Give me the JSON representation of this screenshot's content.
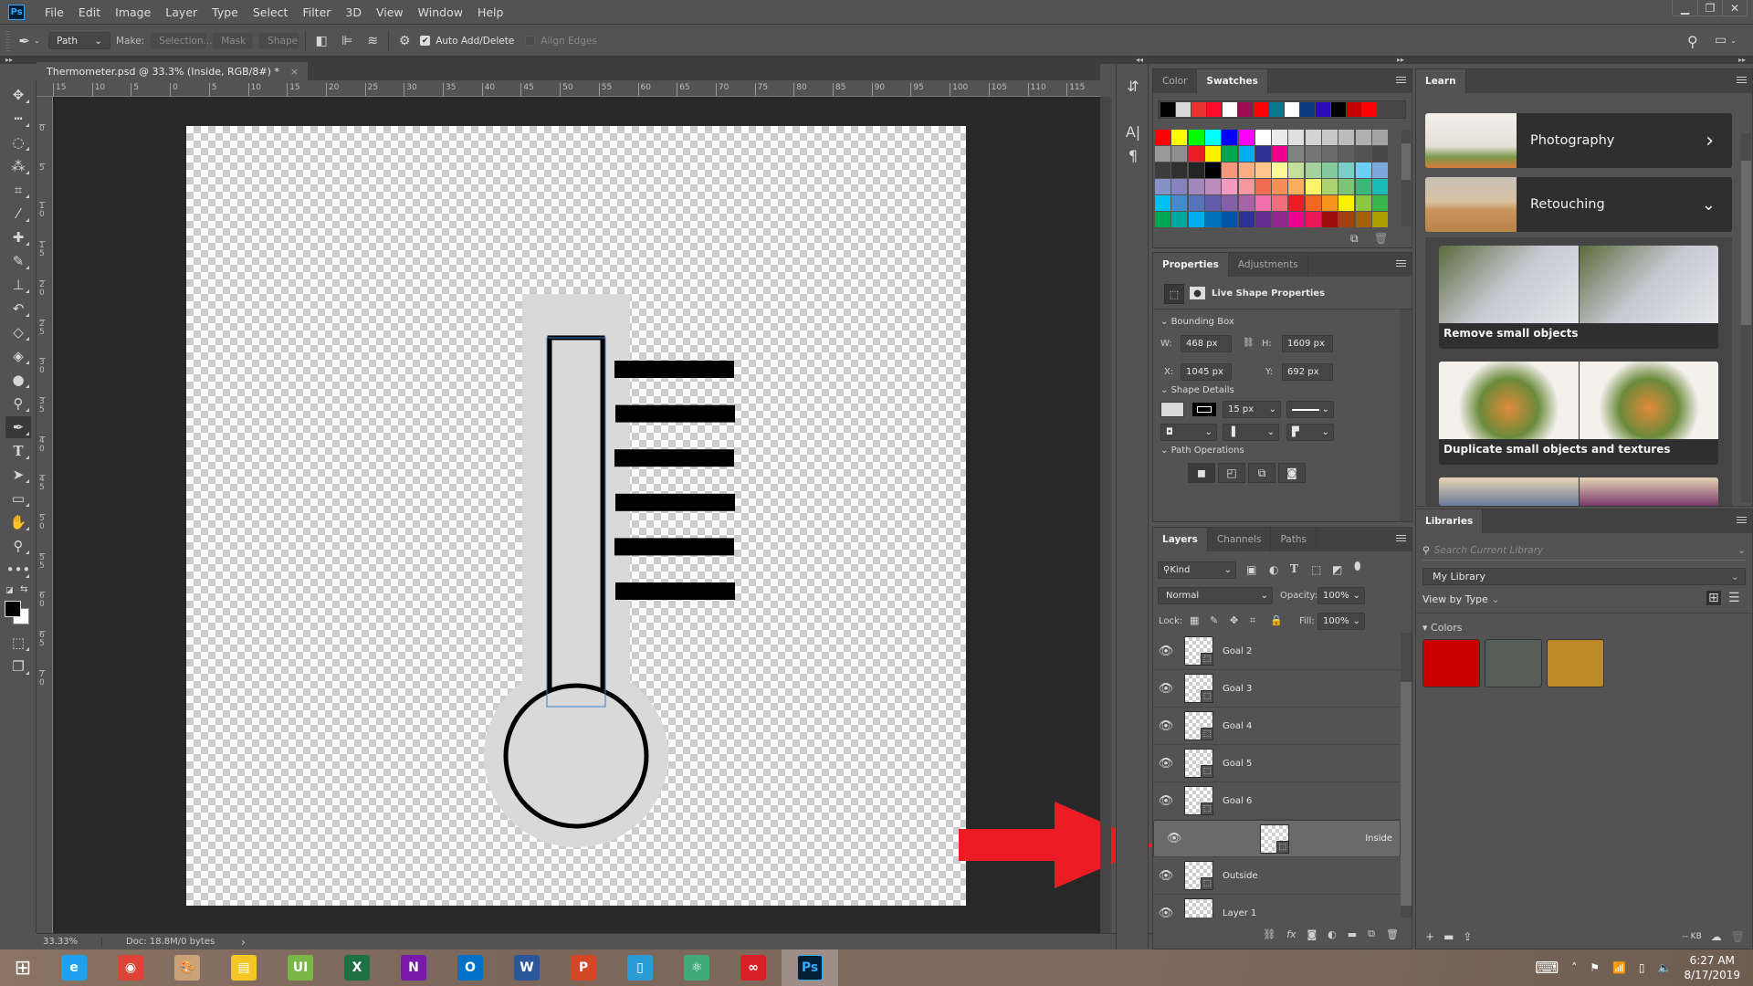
{
  "app": {
    "logo": "Ps",
    "window_controls": [
      "minimize",
      "restore",
      "close"
    ]
  },
  "menu": [
    "File",
    "Edit",
    "Image",
    "Layer",
    "Type",
    "Select",
    "Filter",
    "3D",
    "View",
    "Window",
    "Help"
  ],
  "options_bar": {
    "tool_icon": "pen-icon",
    "mode_select": "Path",
    "make_label": "Make:",
    "make_buttons": [
      "Selection...",
      "Mask",
      "Shape"
    ],
    "auto_add_delete": {
      "label": "Auto Add/Delete",
      "checked": true
    },
    "align_edges": {
      "label": "Align Edges",
      "checked": false
    }
  },
  "document_tab": {
    "title": "Thermometer.psd @ 33.3% (Inside, RGB/8#) *",
    "close": "×"
  },
  "rulers": {
    "top": [
      "15",
      "10",
      "5",
      "0",
      "5",
      "10",
      "15",
      "20",
      "25",
      "30",
      "35",
      "40",
      "45",
      "50",
      "55",
      "60",
      "65",
      "70",
      "75",
      "80",
      "85",
      "90",
      "95",
      "100",
      "105",
      "110",
      "115"
    ],
    "left": [
      "0",
      "5",
      "10",
      "15",
      "20",
      "25",
      "30",
      "35",
      "40",
      "45",
      "50",
      "55",
      "60",
      "65",
      "70"
    ]
  },
  "tools": [
    "move",
    "marquee",
    "lasso",
    "quick-select",
    "crop",
    "eyedropper",
    "healing",
    "brush",
    "stamp",
    "history-brush",
    "eraser",
    "paint-bucket",
    "blur",
    "dodge",
    "pen",
    "type",
    "path-select",
    "rectangle",
    "hand",
    "zoom",
    "more"
  ],
  "active_tool": "pen",
  "canvas": {
    "shape_fill": "#d9d9d9",
    "stroke_color": "#000000",
    "goal_bars": 6,
    "annotation_arrow_color": "#ed1c24"
  },
  "status": {
    "zoom": "33.33%",
    "doc": "Doc: 18.8M/0 bytes",
    "arrow": "›"
  },
  "swatches_panel": {
    "tabs": [
      "Color",
      "Swatches"
    ],
    "active_tab": "Swatches",
    "recent": [
      "#000000",
      "#d9d9d9",
      "#e8322f",
      "#ff0a2c",
      "#ffffff",
      "#9e0b4f",
      "#ff0000",
      "#0e7490",
      "#ffffff",
      "#0b3a80",
      "#2a0db5",
      "#000000",
      "#c40000",
      "#ff0000"
    ],
    "grid": [
      [
        "#ff0000",
        "#ffff00",
        "#00ff00",
        "#00ffff",
        "#0000ff",
        "#ff00ff",
        "#ffffff",
        "#ebebeb",
        "#dfdfdf",
        "#d3d3d3",
        "#c8c8c8",
        "#bcbcbc",
        "#b0b0b0",
        "#a4a4a4"
      ],
      [
        "#999999",
        "#8d8d8d",
        "#ed1c24",
        "#fff200",
        "#00a651",
        "#00aeef",
        "#2e3192",
        "#ec008c",
        "#828282",
        "#767676",
        "#6b6b6b",
        "#5f5f5f",
        "#535353",
        "#474747"
      ],
      [
        "#3c3c3c",
        "#303030",
        "#242424",
        "#000000",
        "#f7977a",
        "#f9ad81",
        "#fdc68a",
        "#fff79a",
        "#c4df9b",
        "#a3d39c",
        "#82ca9d",
        "#7bcdc8",
        "#6dcff6",
        "#7da7d9"
      ],
      [
        "#8393ca",
        "#8781bd",
        "#a187be",
        "#bc8cbf",
        "#f49ac1",
        "#f5989d",
        "#f26c4f",
        "#f68e55",
        "#fbaf5c",
        "#fff467",
        "#acd372",
        "#7cc576",
        "#3bb878",
        "#1abbb4"
      ],
      [
        "#00bff3",
        "#438ccb",
        "#5574b9",
        "#605ca8",
        "#855fa8",
        "#a763a8",
        "#f06eaa",
        "#f26d7d",
        "#ed1c24",
        "#f26522",
        "#f7941d",
        "#fff200",
        "#8dc73f",
        "#39b54a"
      ],
      [
        "#00a651",
        "#00a99d",
        "#00aeef",
        "#0072bc",
        "#0054a6",
        "#2e3192",
        "#662d91",
        "#92278f",
        "#ec008c",
        "#ed145b",
        "#9e0b0f",
        "#a0410d",
        "#a36209",
        "#aba000"
      ]
    ]
  },
  "properties_panel": {
    "tabs": [
      "Properties",
      "Adjustments"
    ],
    "active_tab": "Properties",
    "title": "Live Shape Properties",
    "bounding_box_label": "Bounding Box",
    "w_label": "W:",
    "w": "468 px",
    "h_label": "H:",
    "h": "1609 px",
    "x_label": "X:",
    "x": "1045 px",
    "y_label": "Y:",
    "y": "692 px",
    "shape_details_label": "Shape Details",
    "stroke_width": "15 px",
    "path_operations_label": "Path Operations"
  },
  "layers_panel": {
    "tabs": [
      "Layers",
      "Channels",
      "Paths"
    ],
    "active_tab": "Layers",
    "filter": "Kind",
    "blend_mode": "Normal",
    "opacity_label": "Opacity:",
    "opacity": "100%",
    "lock_label": "Lock:",
    "fill_label": "Fill:",
    "fill": "100%",
    "layers": [
      {
        "name": "Goal 2",
        "visible": true,
        "selected": false
      },
      {
        "name": "Goal 3",
        "visible": true,
        "selected": false
      },
      {
        "name": "Goal 4",
        "visible": true,
        "selected": false
      },
      {
        "name": "Goal 5",
        "visible": true,
        "selected": false
      },
      {
        "name": "Goal 6",
        "visible": true,
        "selected": false
      },
      {
        "name": "Inside",
        "visible": true,
        "selected": true
      },
      {
        "name": "Outside",
        "visible": true,
        "selected": false
      },
      {
        "name": "Layer 1",
        "visible": true,
        "selected": false
      }
    ]
  },
  "learn_panel": {
    "tab": "Learn",
    "topics": [
      {
        "title": "Photography",
        "chevron": "›"
      },
      {
        "title": "Retouching",
        "chevron": "⌄"
      }
    ],
    "tutorials": [
      "Remove small objects",
      "Duplicate small objects and textures"
    ]
  },
  "libraries_panel": {
    "tab": "Libraries",
    "search_placeholder": "Search Current Library",
    "library": "My Library",
    "view_by": "View by Type",
    "colors_label": "Colors",
    "colors": [
      "#cc0000",
      "#545d58",
      "#bb8a26"
    ],
    "size": "-- KB"
  },
  "taskbar": {
    "apps": [
      "Internet Explorer",
      "Chrome",
      "Paint",
      "File Explorer",
      "UI",
      "Excel",
      "OneNote",
      "Outlook",
      "Word",
      "PowerPoint",
      "Brackets",
      "Atom",
      "Creative Cloud",
      "Photoshop"
    ],
    "time": "6:27 AM",
    "date": "8/17/2019"
  }
}
